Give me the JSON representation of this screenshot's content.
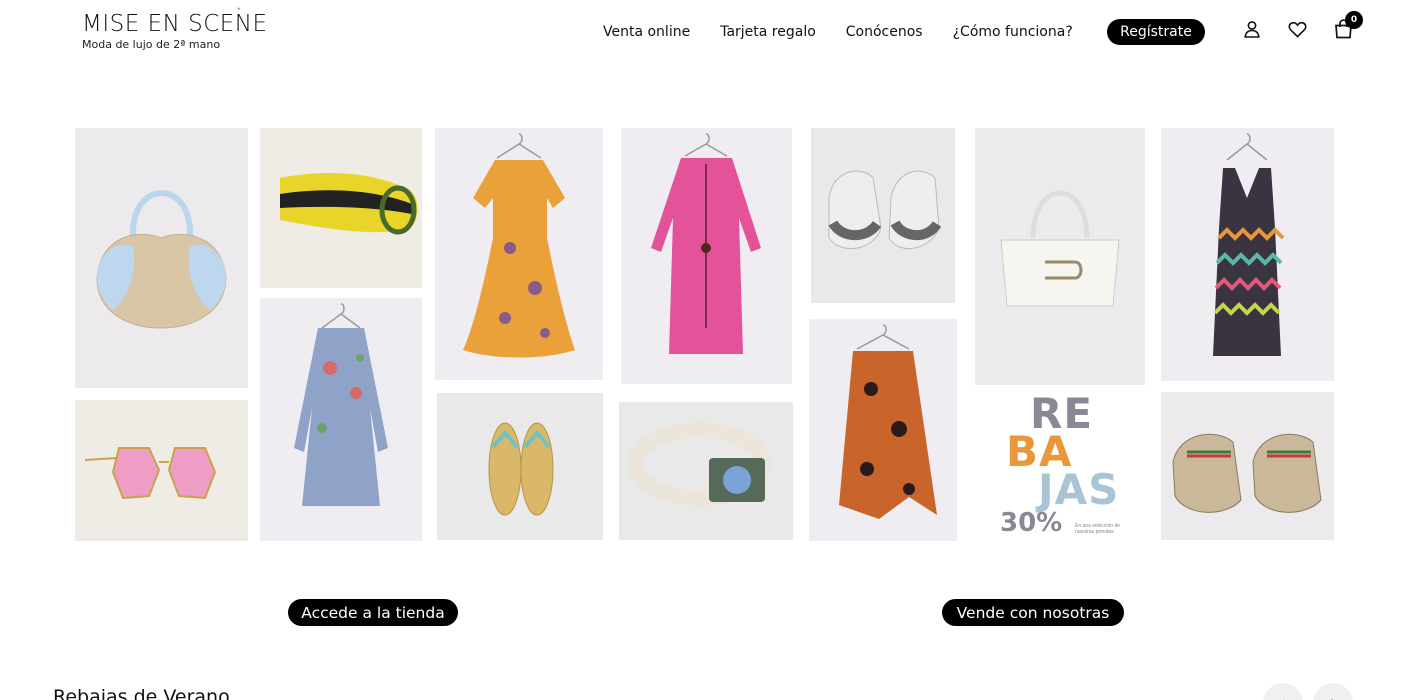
{
  "brand": {
    "logo_text": "MISE EN SCENE",
    "logo_accent": "`",
    "tagline": "Moda de lujo de 2ª mano"
  },
  "nav": {
    "items": [
      {
        "label": "Venta online"
      },
      {
        "label": "Tarjeta regalo"
      },
      {
        "label": "Conócenos"
      },
      {
        "label": "¿Cómo funciona?"
      }
    ],
    "register_label": "Regístrate"
  },
  "header_icons": {
    "user": "user-icon",
    "wishlist": "heart-icon",
    "cart": "bag-icon",
    "cart_count": "0"
  },
  "collage": {
    "items": [
      {
        "name": "handbag-beige-blue",
        "desc_icon": "handbag-icon"
      },
      {
        "name": "belt-yellow-black",
        "desc_icon": "belt-icon"
      },
      {
        "name": "dress-orange-floral",
        "desc_icon": "dress-icon"
      },
      {
        "name": "dress-pink",
        "desc_icon": "dress-icon"
      },
      {
        "name": "sneakers-gray",
        "desc_icon": "sneaker-icon"
      },
      {
        "name": "handbag-white",
        "desc_icon": "handbag-icon"
      },
      {
        "name": "dress-zigzag",
        "desc_icon": "dress-icon"
      },
      {
        "name": "sunglasses-pink",
        "desc_icon": "sunglasses-icon"
      },
      {
        "name": "dress-blue-floral",
        "desc_icon": "dress-icon"
      },
      {
        "name": "sandals-gold",
        "desc_icon": "sandal-icon"
      },
      {
        "name": "belt-white",
        "desc_icon": "belt-icon"
      },
      {
        "name": "skirt-orange-floral",
        "desc_icon": "skirt-icon"
      },
      {
        "name": "sneakers-gucci",
        "desc_icon": "sneaker-icon"
      }
    ],
    "promo": {
      "line1": "RE",
      "line2": "BA",
      "line3": "JAS",
      "percent": "30%",
      "fine_print": "En una selección de nuestras prendas",
      "colors": {
        "gray": "#8a8796",
        "orange": "#e8983a",
        "blue": "#a9c4d4"
      }
    }
  },
  "cta": {
    "shop_label": "Accede a la tienda",
    "sell_label": "Vende con nosotras"
  },
  "section": {
    "title": "Rebajas de Verano",
    "prev_icon": "chevron-left-icon",
    "next_icon": "chevron-right-icon"
  },
  "colors": {
    "accent": "#000000",
    "background": "#ffffff"
  }
}
